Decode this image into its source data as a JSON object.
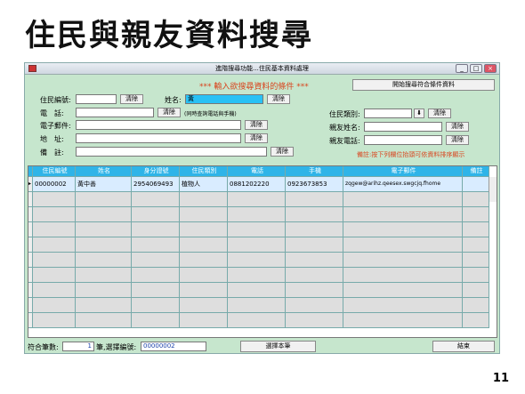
{
  "slide": {
    "title": "住民與親友資料搜尋",
    "page_number": "11"
  },
  "window": {
    "title": "進階搜尋功能...住民基本資料處理",
    "buttons": [
      "_",
      "□",
      "×"
    ]
  },
  "header": {
    "text": "*** 輸入欲搜尋資料的條件 ***",
    "start_search_label": "開始搜尋符合條件資料"
  },
  "form": {
    "resident_id_label": "住民編號:",
    "name_label": "姓名:",
    "name_value": "黃",
    "phone_label": "電　話:",
    "phone_hint": "(同時查詢電話與手機)",
    "email_label": "電子郵件:",
    "address_label": "地　址:",
    "memo_label": "備　註:",
    "category_label": "住民類別:",
    "relative_name_label": "親友姓名:",
    "relative_phone_label": "親友電話:",
    "clear_label": "清除",
    "note": "備註:按下列欄位抬頭可依資料排序顯示"
  },
  "grid": {
    "columns": [
      "住民編號",
      "姓名",
      "身分證號",
      "住民類別",
      "電話",
      "手機",
      "電子郵件",
      "備註"
    ],
    "rows": [
      [
        "00000002",
        "黃中善",
        "2954069493",
        "植物人",
        "0881202220",
        "0923673853",
        "zqgew@arihz.qeesex.swgcjq.fhome",
        ""
      ]
    ]
  },
  "footer": {
    "count_label": "符合筆數:",
    "count_value": "1",
    "selected_label": "筆,選擇編號:",
    "selected_value": "00000002",
    "select_button": "選擇本筆",
    "end_button": "結束"
  }
}
